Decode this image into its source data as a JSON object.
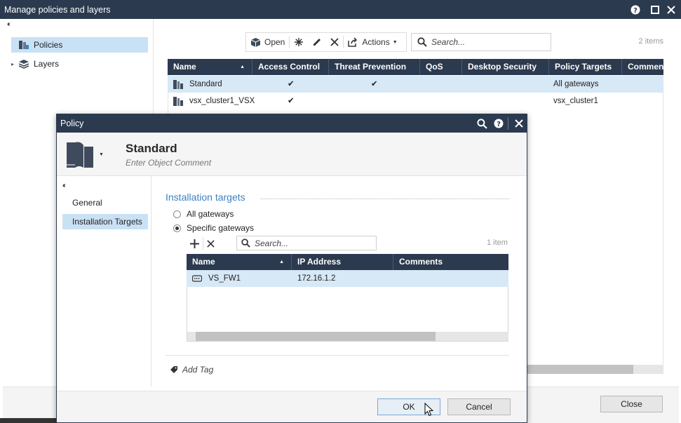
{
  "window": {
    "title": "Manage policies and layers",
    "nav": [
      {
        "label": "Policies",
        "selected": true
      },
      {
        "label": "Layers",
        "selected": false
      }
    ],
    "toolbar": {
      "open_label": "Open",
      "actions_label": "Actions",
      "search_placeholder": "Search...",
      "items_count": "2 items"
    },
    "grid": {
      "columns": [
        "Name",
        "Access Control",
        "Threat Prevention",
        "QoS",
        "Desktop Security",
        "Policy Targets",
        "Commen"
      ],
      "rows": [
        {
          "name": "Standard",
          "access_control": "✔",
          "threat_prevention": "✔",
          "policy_targets": "All gateways",
          "selected": true
        },
        {
          "name": "vsx_cluster1_VSX",
          "access_control": "✔",
          "threat_prevention": "",
          "policy_targets": "vsx_cluster1",
          "selected": false
        }
      ]
    },
    "close_label": "Close"
  },
  "dialog": {
    "title": "Policy",
    "object_name": "Standard",
    "object_comment": "Enter Object Comment",
    "nav": [
      {
        "label": "General",
        "selected": false
      },
      {
        "label": "Installation Targets",
        "selected": true
      }
    ],
    "section_title": "Installation targets",
    "radios": [
      {
        "label": "All gateways",
        "checked": false
      },
      {
        "label": "Specific gateways",
        "checked": true
      }
    ],
    "search_placeholder": "Search...",
    "items_count": "1 item",
    "table": {
      "columns": [
        "Name",
        "IP Address",
        "Comments"
      ],
      "rows": [
        {
          "name": "VS_FW1",
          "ip": "172.16.1.2",
          "comments": ""
        }
      ]
    },
    "add_tag_label": "Add Tag",
    "ok_label": "OK",
    "cancel_label": "Cancel"
  },
  "colors": {
    "titlebar": "#2b3a4f",
    "selection": "#c9e1f5",
    "section_title": "#3a82c4"
  }
}
